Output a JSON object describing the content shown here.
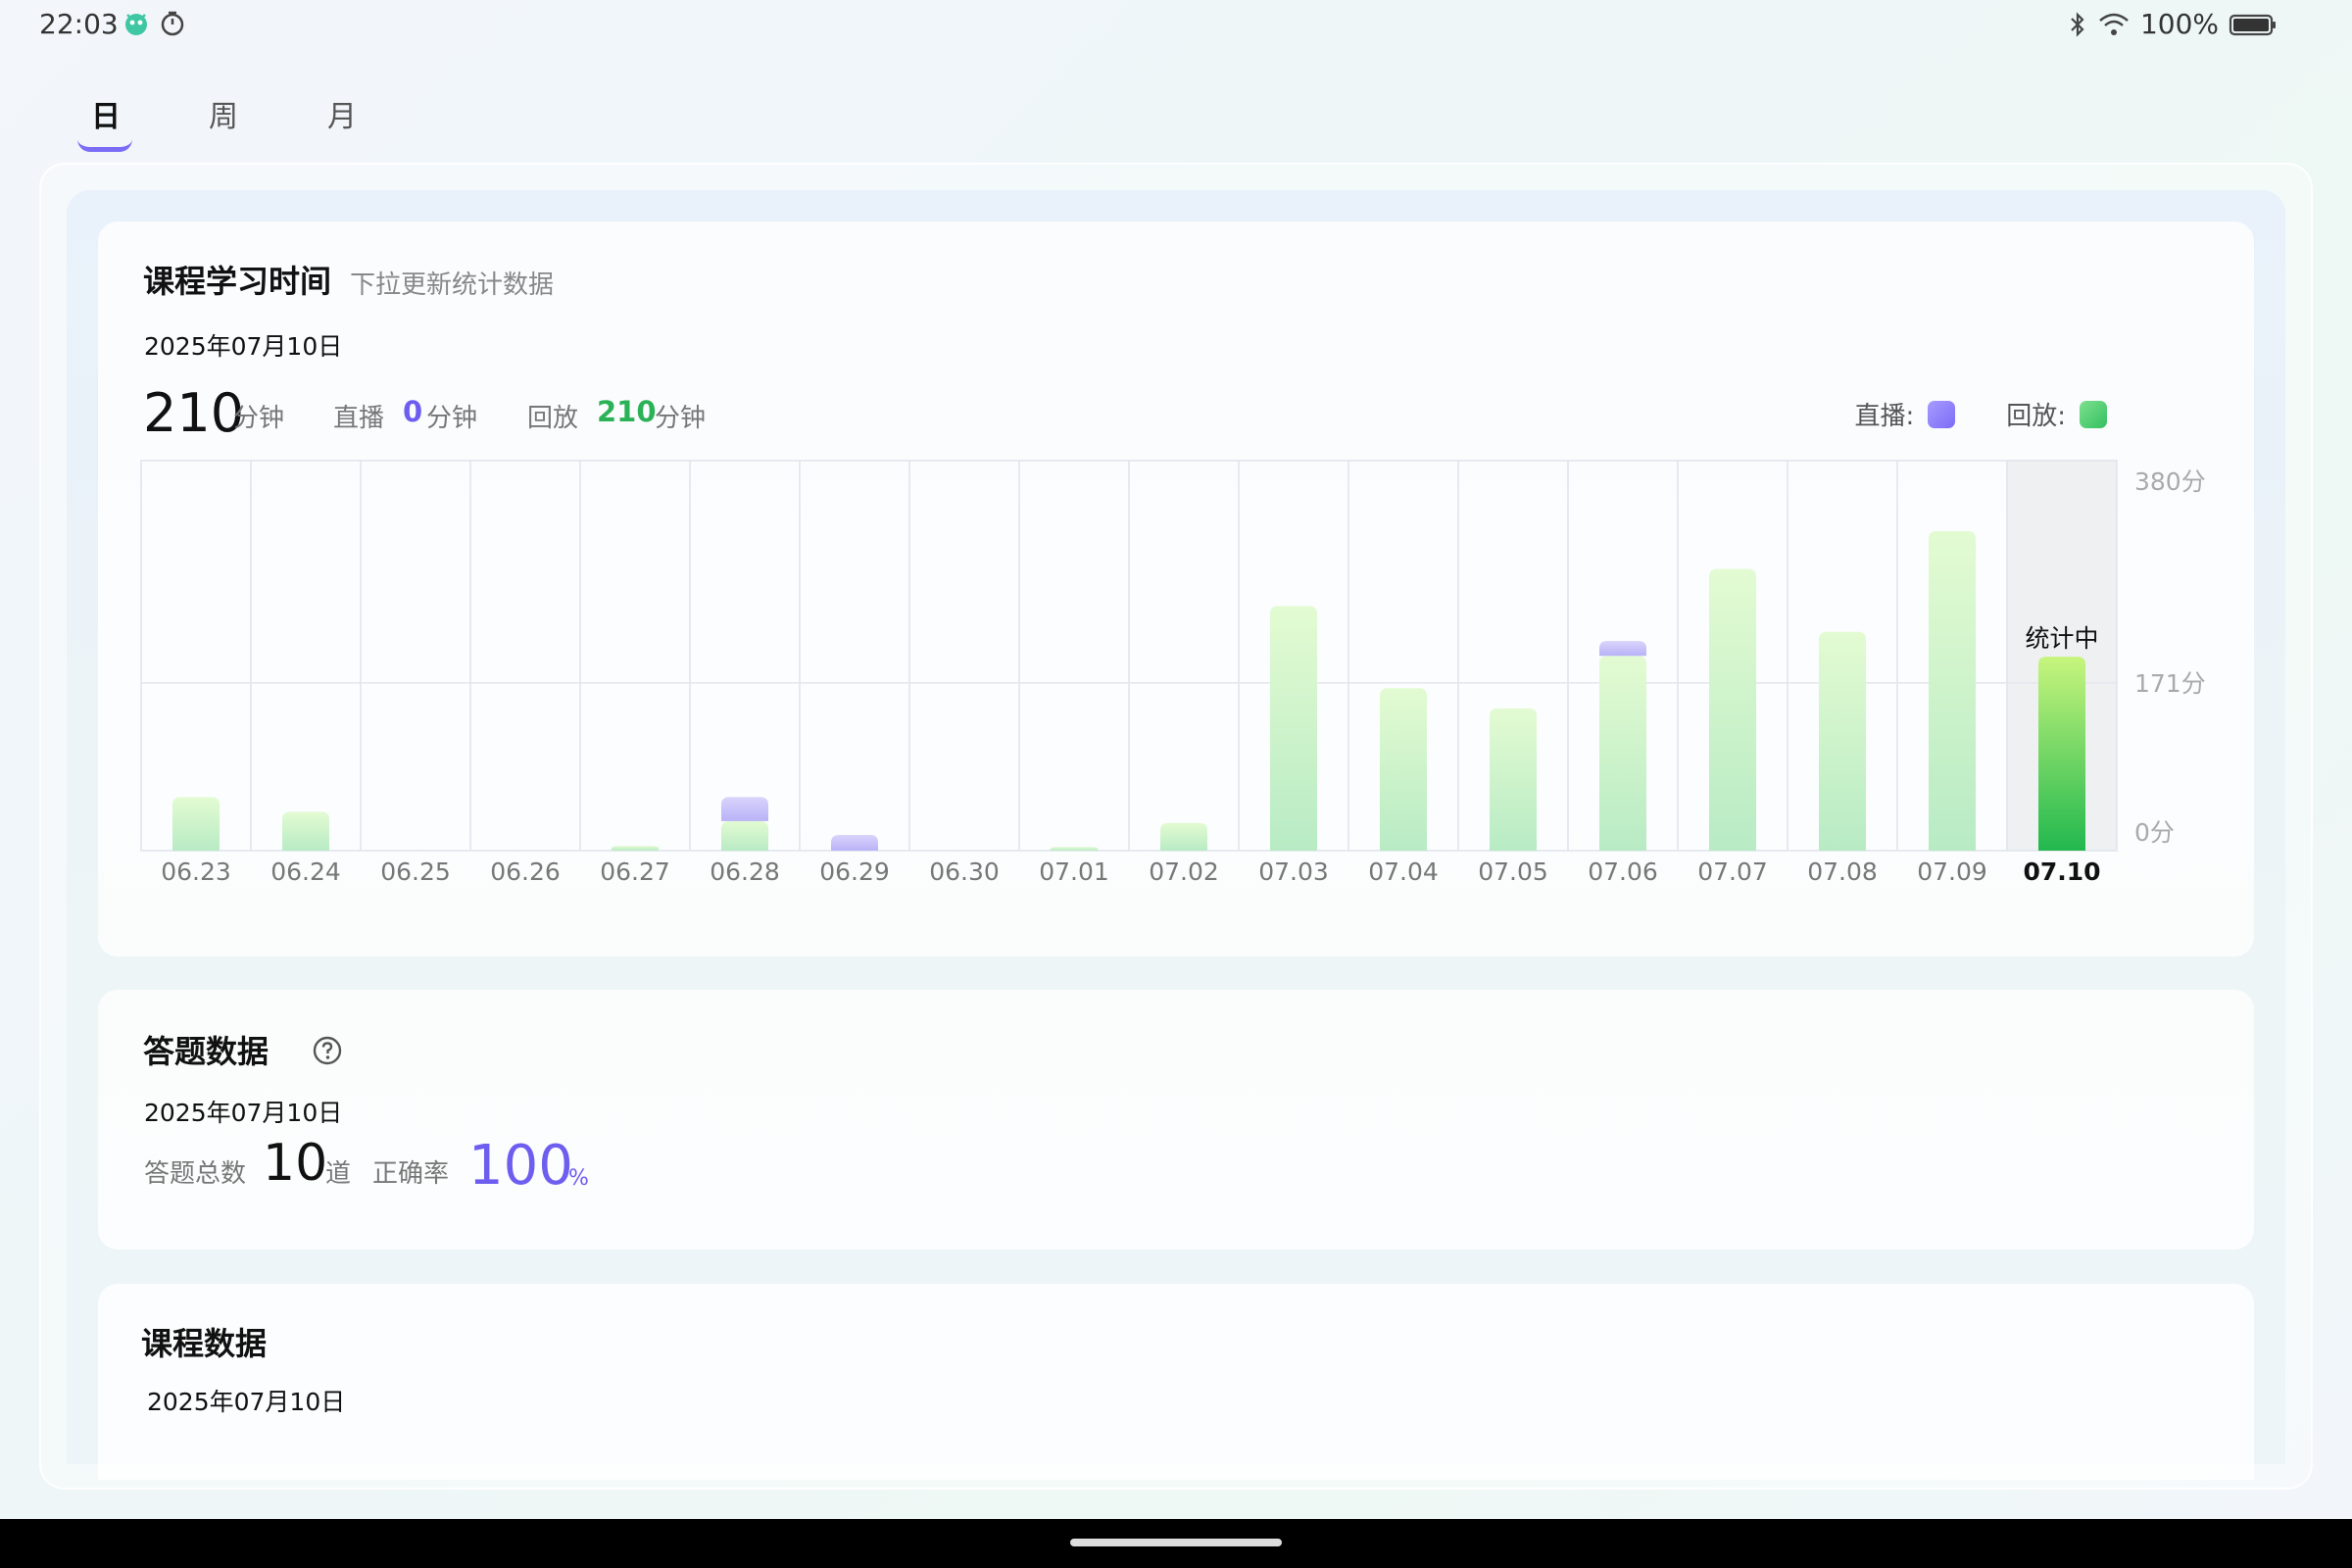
{
  "status_bar": {
    "time": "22:03",
    "battery_text": "100%"
  },
  "tabs": [
    {
      "label": "日"
    },
    {
      "label": "周"
    },
    {
      "label": "月"
    }
  ],
  "study_card": {
    "title": "课程学习时间",
    "hint": "下拉更新统计数据",
    "date": "2025年07月10日",
    "total": "210",
    "total_unit": "分钟",
    "live_label": "直播",
    "live_value": "0",
    "live_unit": "分钟",
    "replay_label": "回放",
    "replay_value": "210",
    "replay_unit": "分钟",
    "legend_live": "直播:",
    "legend_replay": "回放:"
  },
  "colors": {
    "accent_purple": "#6e5ef0",
    "accent_green": "#2cb256",
    "live_bar": "#b9b2f7",
    "replay_bar": "#c8efcf"
  },
  "chart_data": {
    "type": "bar",
    "stacked": true,
    "categories": [
      "06.23",
      "06.24",
      "06.25",
      "06.26",
      "06.27",
      "06.28",
      "06.29",
      "06.30",
      "07.01",
      "07.02",
      "07.03",
      "07.04",
      "07.05",
      "07.06",
      "07.07",
      "07.08",
      "07.09",
      "07.10"
    ],
    "series": [
      {
        "name": "直播",
        "values": [
          0,
          0,
          0,
          0,
          0,
          26,
          17,
          0,
          0,
          0,
          0,
          0,
          0,
          16,
          0,
          0,
          0,
          0
        ]
      },
      {
        "name": "回放",
        "values": [
          58,
          42,
          0,
          0,
          5,
          32,
          0,
          0,
          4,
          30,
          265,
          176,
          154,
          211,
          305,
          237,
          346,
          210
        ]
      }
    ],
    "ylim": [
      0,
      380
    ],
    "y_ticks": [
      "0分",
      "171分",
      "380分"
    ],
    "selected": "07.10",
    "selected_note": "统计中",
    "grid": true
  },
  "answer_card": {
    "title": "答题数据",
    "date": "2025年07月10日",
    "total_label": "答题总数",
    "total_value": "10",
    "total_unit": "道",
    "accuracy_label": "正确率",
    "accuracy_value": "100",
    "accuracy_unit": "%"
  },
  "course_card": {
    "title": "课程数据",
    "date": "2025年07月10日"
  }
}
